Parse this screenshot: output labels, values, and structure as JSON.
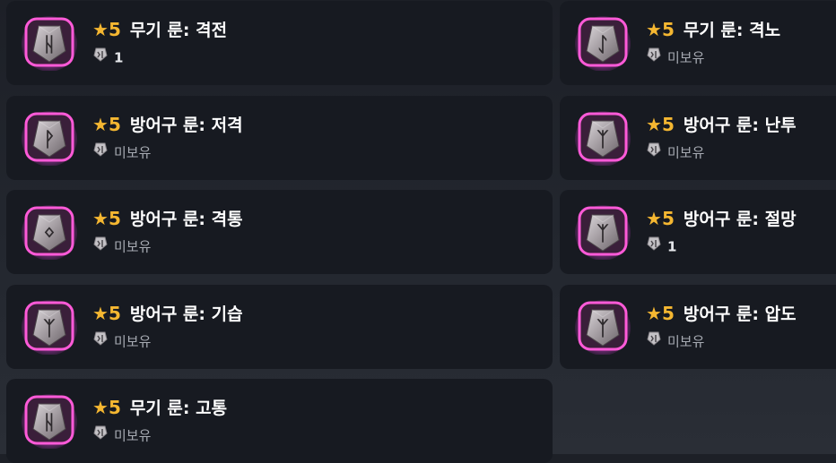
{
  "colors": {
    "grade_star": "#f5b731",
    "glow": "#e040e0",
    "frame": "#ff5ad8",
    "card_bg": "#171a21"
  },
  "runes": [
    {
      "star": "★",
      "grade": "5",
      "name": "무기 룬: 격전",
      "owned": "1",
      "glyph": "ᚺ",
      "owner_icon": "stone-icon"
    },
    {
      "star": "★",
      "grade": "5",
      "name": "무기 룬: 격노",
      "owned": "미보유",
      "glyph": "ᛇ",
      "owner_icon": "stone-icon"
    },
    {
      "star": "★",
      "grade": "5",
      "name": "방어구 룬: 저격",
      "owned": "미보유",
      "glyph": "ᚹ",
      "owner_icon": "stone-icon"
    },
    {
      "star": "★",
      "grade": "5",
      "name": "방어구 룬: 난투",
      "owned": "미보유",
      "glyph": "ᛉ",
      "owner_icon": "stone-icon"
    },
    {
      "star": "★",
      "grade": "5",
      "name": "방어구 룬: 격통",
      "owned": "미보유",
      "glyph": "ᛜ",
      "owner_icon": "stone-icon"
    },
    {
      "star": "★",
      "grade": "5",
      "name": "방어구 룬: 절망",
      "owned": "1",
      "glyph": "ᛉ",
      "owner_icon": "stone-icon"
    },
    {
      "star": "★",
      "grade": "5",
      "name": "방어구 룬: 기습",
      "owned": "미보유",
      "glyph": "ᛉ",
      "owner_icon": "stone-icon"
    },
    {
      "star": "★",
      "grade": "5",
      "name": "방어구 룬: 압도",
      "owned": "미보유",
      "glyph": "ᛉ",
      "owner_icon": "stone-icon"
    },
    {
      "star": "★",
      "grade": "5",
      "name": "무기 룬: 고통",
      "owned": "미보유",
      "glyph": "ᚺ",
      "owner_icon": "stone-icon"
    }
  ]
}
